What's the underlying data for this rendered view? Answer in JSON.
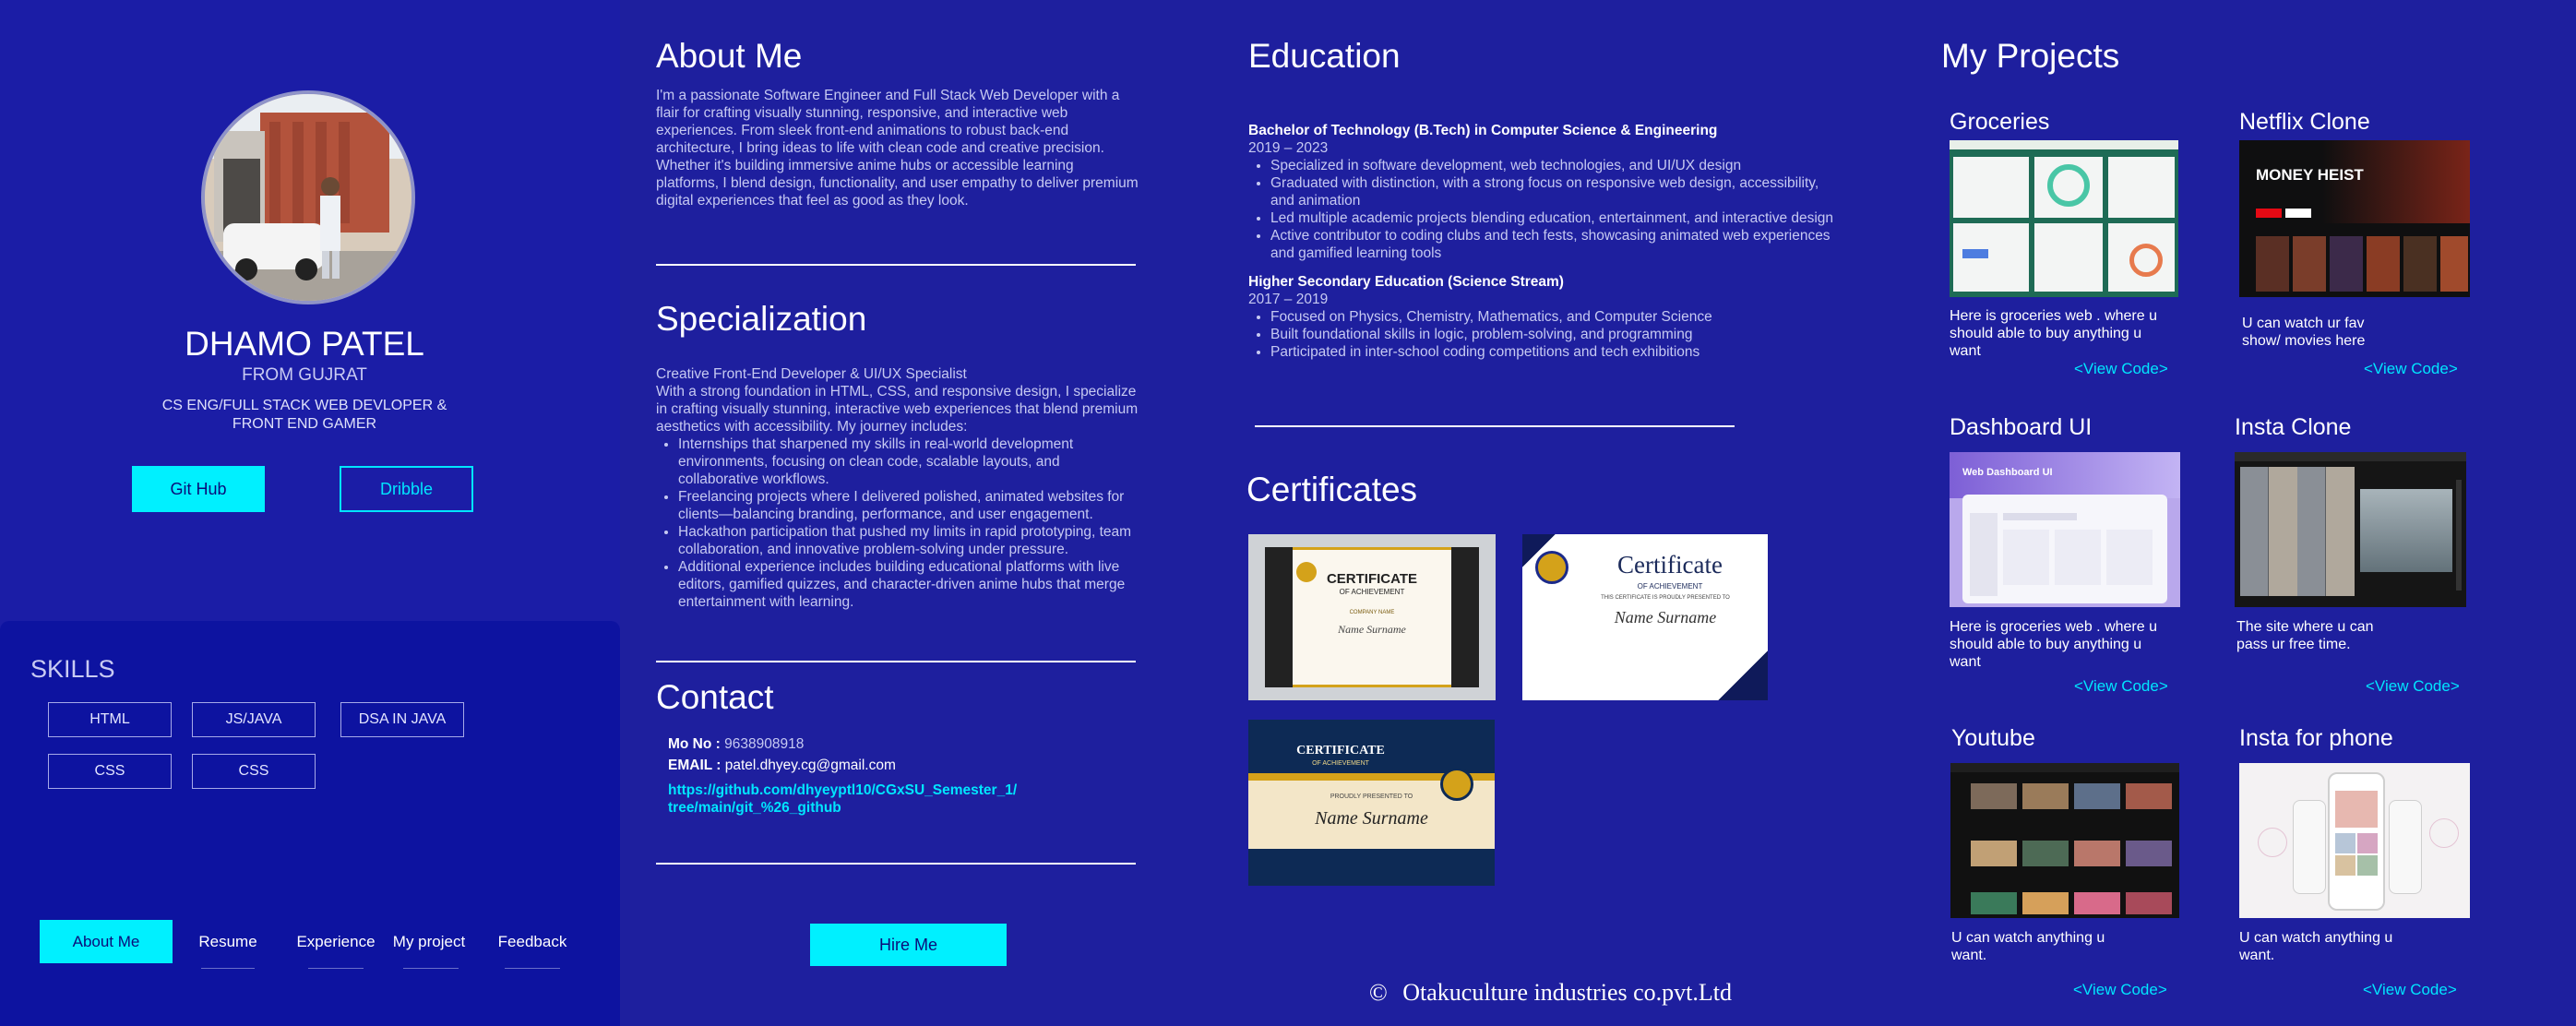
{
  "profile": {
    "name": "DHAMO PATEL",
    "from": "FROM GUJRAT",
    "role_line1": "CS ENG/FULL STACK WEB DEVLOPER &",
    "role_line2": "FRONT END GAMER",
    "github_label": "Git Hub",
    "dribble_label": "Dribble"
  },
  "skills": {
    "title": "SKILLS",
    "items": [
      "HTML",
      "JS/JAVA",
      "DSA IN JAVA",
      "CSS",
      "CSS"
    ]
  },
  "nav": {
    "items": [
      "About Me",
      "Resume",
      "Experience",
      "My project",
      "Feedback"
    ],
    "active": "About Me"
  },
  "about": {
    "title": "About Me",
    "text": "I'm a passionate Software Engineer and Full Stack Web Developer with a flair for crafting visually stunning, responsive, and interactive web experiences. From sleek front-end animations to robust back-end architecture, I bring ideas to life with clean code and creative precision. Whether it's building immersive anime hubs or accessible learning platforms, I blend design, functionality, and user empathy to deliver premium digital experiences that feel as good as they look."
  },
  "specialization": {
    "title": "Specialization",
    "headline": "Creative Front-End Developer & UI/UX Specialist",
    "intro": " With a strong foundation in HTML, CSS, and responsive design, I specialize in crafting visually stunning, interactive web experiences that blend premium aesthetics with accessibility. My journey includes:",
    "bullets": [
      "Internships that sharpened my skills in real-world development environments, focusing on clean code, scalable layouts, and collaborative workflows.",
      "Freelancing projects where I delivered polished, animated websites for clients—balancing branding, performance, and user engagement.",
      "Hackathon participation that pushed my limits in rapid prototyping, team collaboration, and innovative problem-solving under pressure.",
      "Additional experience includes building educational platforms with live editors, gamified quizzes, and character-driven anime hubs that merge entertainment with learning."
    ]
  },
  "contact": {
    "title": "Contact",
    "mo_label": "Mo No :",
    "mo_value": "9638908918",
    "email_label": "EMAIL :",
    "email_value": "patel.dhyey.cg@gmail.com",
    "link_line1": "https://github.com/dhyeyptl10/CGxSU_Semester_1/",
    "link_line2": "tree/main/git_%26_github",
    "hire_label": "Hire Me"
  },
  "education": {
    "title": "Education",
    "entries": [
      {
        "degree": "Bachelor of Technology (B.Tech) in Computer Science & Engineering",
        "years": "2019 – 2023",
        "bullets": [
          "Specialized in software development, web technologies, and UI/UX design",
          "Graduated with distinction, with a strong focus on responsive web design, accessibility, and animation",
          "Led multiple academic projects blending education, entertainment, and interactive design",
          "Active contributor to coding clubs and tech fests, showcasing animated web experiences and gamified learning tools"
        ]
      },
      {
        "degree": "Higher Secondary Education (Science Stream)",
        "years": "2017 – 2019",
        "bullets": [
          "Focused on Physics, Chemistry, Mathematics, and Computer Science",
          "Built foundational skills in logic, problem-solving, and programming",
          "Participated in inter-school coding competitions and tech exhibitions"
        ]
      }
    ]
  },
  "certificates": {
    "title": "Certificates",
    "items": [
      {
        "heading": "CERTIFICATE",
        "sub": "OF ACHIEVEMENT",
        "name": "Name Surname",
        "tag": "COMPANY NAME"
      },
      {
        "heading": "Certificate",
        "sub": "OF ACHIEVEMENT",
        "name": "Name Surname",
        "tag": "THIS CERTIFICATE IS PROUDLY PRESENTED TO"
      },
      {
        "heading": "CERTIFICATE",
        "sub": "OF ACHIEVEMENT",
        "name": "Name Surname",
        "tag": "PROUDLY PRESENTED TO"
      }
    ]
  },
  "footer": {
    "copyright_symbol": "©",
    "company": "Otakuculture industries co.pvt.Ltd"
  },
  "projects": {
    "title": "My Projects",
    "items": [
      {
        "title": "Groceries",
        "desc": "Here is groceries web . where u should able to buy anything u want",
        "link": "<View Code>"
      },
      {
        "title": "Netflix Clone",
        "desc": "U can watch ur fav show/ movies here",
        "link": "<View Code>",
        "thumb_text": "MONEY HEIST"
      },
      {
        "title": "Dashboard UI",
        "desc": "Here is groceries web . where u should able to buy anything u want",
        "link": "<View Code>",
        "thumb_text": "Web Dashboard UI"
      },
      {
        "title": "Insta Clone",
        "desc": "The site where u can pass ur free time.",
        "link": "<View Code>"
      },
      {
        "title": "Youtube",
        "desc": "U can watch anything u want.",
        "link": "<View Code>"
      },
      {
        "title": "Insta for phone",
        "desc": "U can watch anything u want.",
        "link": "<View Code>"
      }
    ]
  },
  "colors": {
    "background": "#1e1f9e",
    "accent": "#00f0ff",
    "panel": "#1b1da6"
  }
}
